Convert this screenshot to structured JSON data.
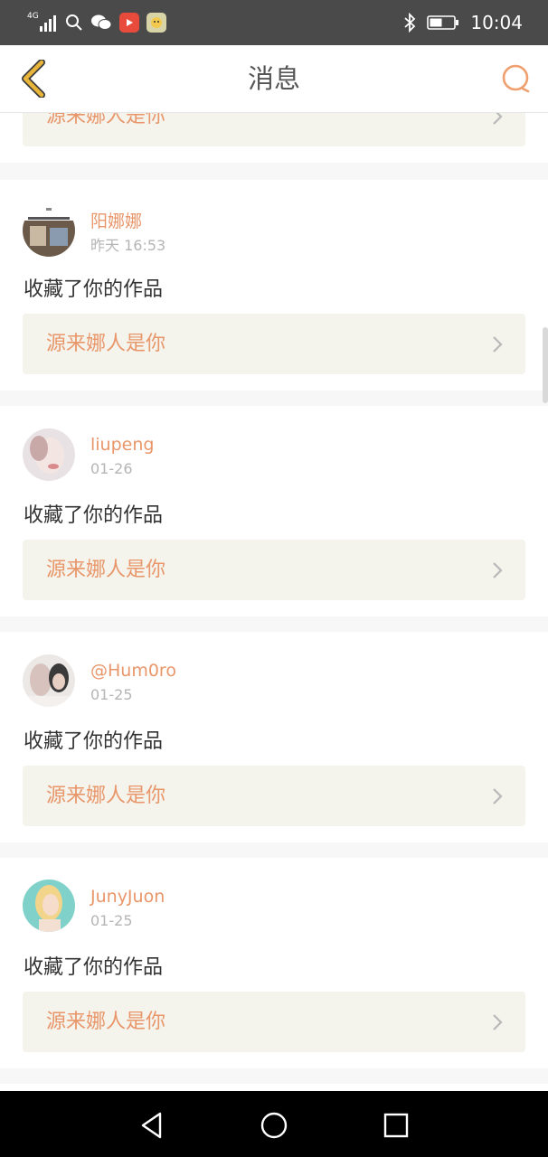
{
  "status_bar": {
    "network": "4G",
    "time": "10:04",
    "icons": [
      "signal-icon",
      "search-icon",
      "wechat-icon",
      "video-app-icon",
      "emoji-app-icon",
      "bluetooth-icon",
      "battery-icon"
    ]
  },
  "header": {
    "title": "消息",
    "back_icon": "chevron-left-icon",
    "search_icon": "search-icon"
  },
  "colors": {
    "accent": "#e8966a",
    "back_arrow": "#e8b43a",
    "link_bg": "#f4f3ec",
    "divider": "#f7f7f7"
  },
  "top_partial": {
    "work_title": "源来娜人是你"
  },
  "messages": [
    {
      "username": "阳娜娜",
      "time": "昨天 16:53",
      "action": "收藏了你的作品",
      "work_title": "源来娜人是你"
    },
    {
      "username": "liupeng",
      "time": "01-26",
      "action": "收藏了你的作品",
      "work_title": "源来娜人是你"
    },
    {
      "username": "@Hum0ro",
      "time": "01-25",
      "action": "收藏了你的作品",
      "work_title": "源来娜人是你"
    },
    {
      "username": "JunyJuon",
      "time": "01-25",
      "action": "收藏了你的作品",
      "work_title": "源来娜人是你"
    }
  ],
  "nav": {
    "back_icon": "triangle-back-icon",
    "home_icon": "circle-home-icon",
    "recent_icon": "square-recent-icon"
  }
}
